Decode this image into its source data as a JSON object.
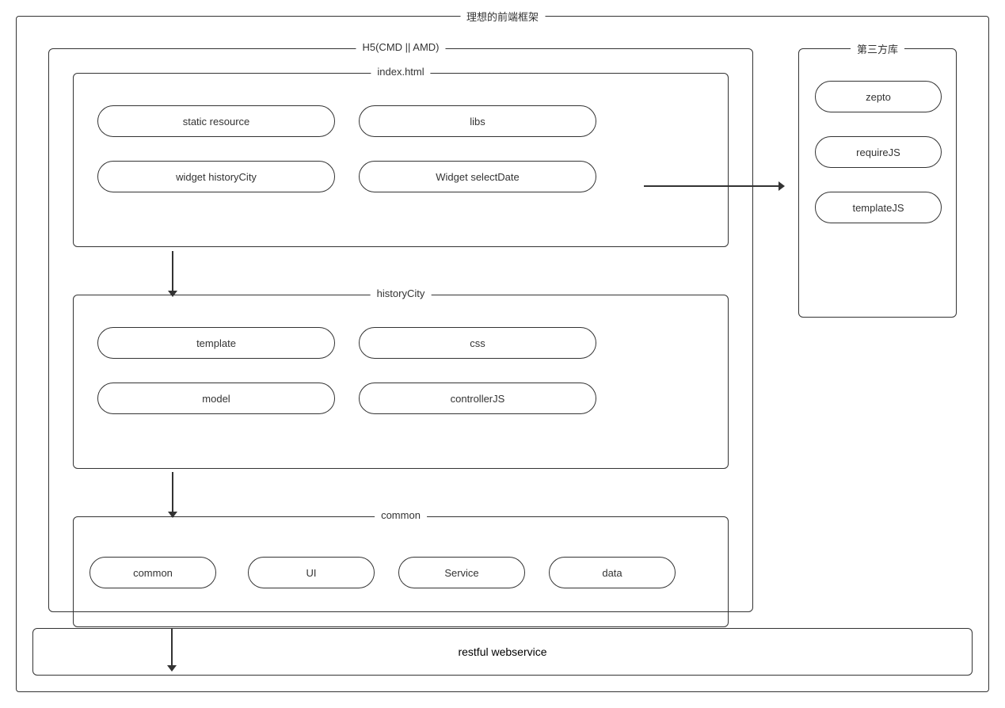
{
  "main": {
    "title": "理想的前端框架"
  },
  "h5": {
    "title": "H5(CMD || AMD)"
  },
  "indexHtml": {
    "title": "index.html",
    "pills": {
      "static_resource": "static resource",
      "libs": "libs",
      "widget_history": "widget historyCity",
      "widget_select": "Widget selectDate"
    }
  },
  "historyCity": {
    "title": "historyCity",
    "pills": {
      "template": "template",
      "css": "css",
      "model": "model",
      "controller": "controllerJS"
    }
  },
  "commonOuter": {
    "title": "common",
    "pills": {
      "common": "common",
      "ui": "UI",
      "service": "Service",
      "data": "data"
    }
  },
  "thirdParty": {
    "title": "第三方库",
    "pills": {
      "zepto": "zepto",
      "requirejs": "requireJS",
      "templatejs": "templateJS"
    }
  },
  "restful": {
    "label": "restful webservice"
  }
}
